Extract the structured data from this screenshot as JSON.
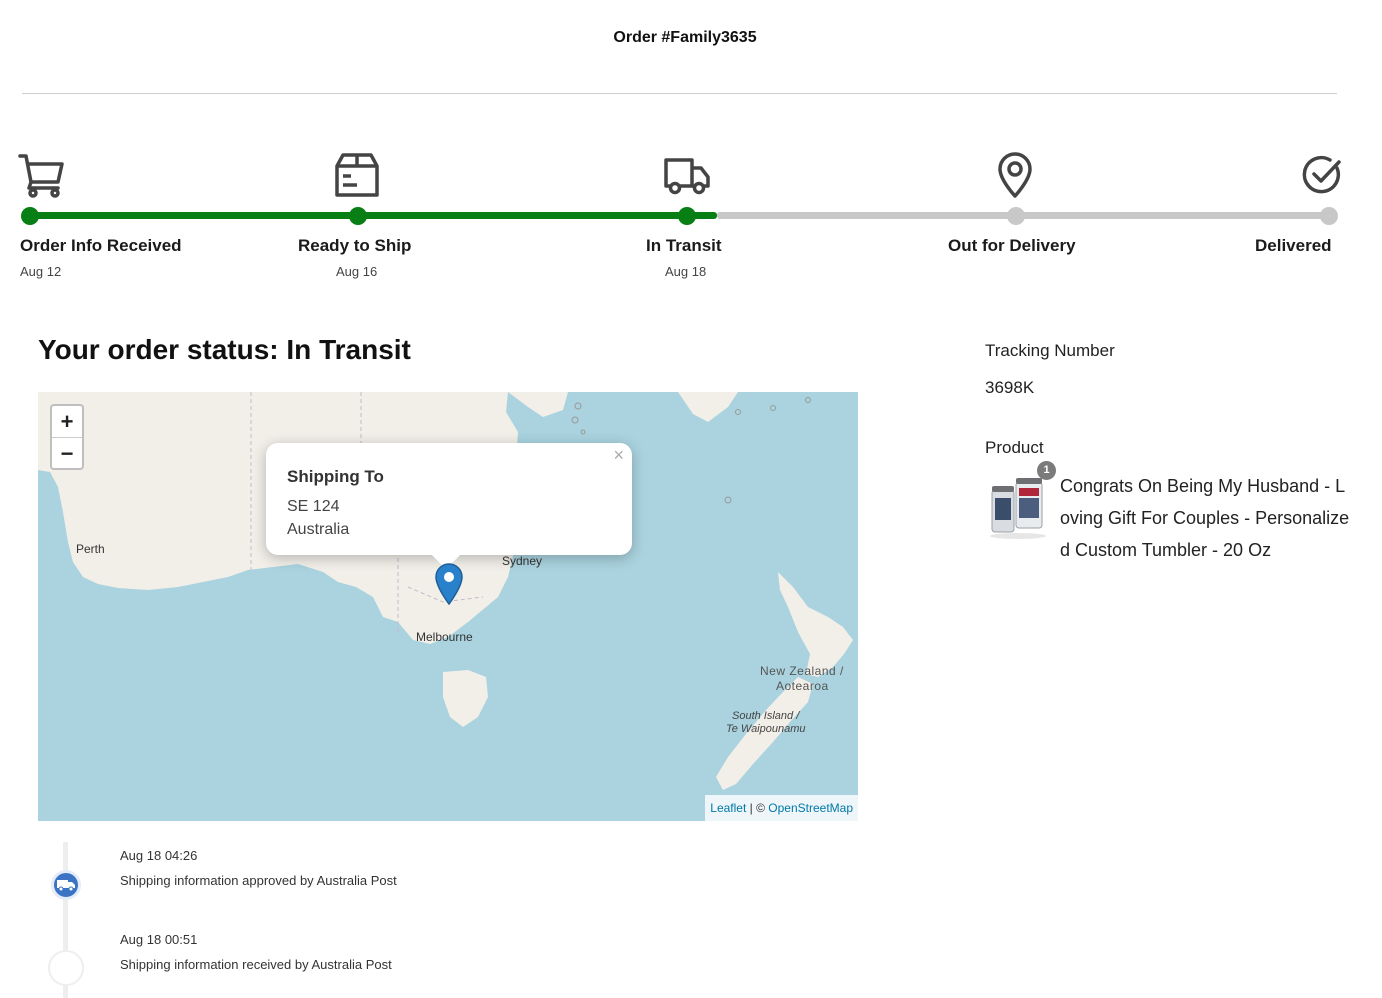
{
  "order": {
    "title": "Order  #Family3635"
  },
  "tracker": {
    "steps": [
      {
        "label": "Order Info Received",
        "date": "Aug 12",
        "icon": "cart-icon",
        "completed": true
      },
      {
        "label": "Ready to Ship",
        "date": "Aug 16",
        "icon": "package-icon",
        "completed": true
      },
      {
        "label": "In Transit",
        "date": "Aug 18",
        "icon": "truck-icon",
        "completed": true
      },
      {
        "label": "Out for Delivery",
        "date": "",
        "icon": "location-pin-icon",
        "completed": false
      },
      {
        "label": "Delivered",
        "date": "",
        "icon": "check-circle-icon",
        "completed": false
      }
    ],
    "colors": {
      "completed": "#087f14",
      "pending": "#c8c8c8"
    }
  },
  "status": {
    "heading": "Your order status: In Transit"
  },
  "map": {
    "zoom_in": "+",
    "zoom_out": "−",
    "labels": {
      "perth": "Perth",
      "sydney": "Sydney",
      "melbourne": "Melbourne",
      "nz_line1": "New Zealand /",
      "nz_line2": "Aotearoa",
      "si_line1": "South Island /",
      "si_line2": "Te Waipounamu"
    },
    "popup": {
      "close": "×",
      "title": "Shipping To",
      "line1": "SE 124",
      "line2": "Australia"
    },
    "attribution": {
      "leaflet": "Leaflet",
      "separator": " | © ",
      "osm": "OpenStreetMap"
    },
    "colors": {
      "water": "#aad3df",
      "land": "#f2efe9",
      "pin": "#2a81cb"
    }
  },
  "tracking": {
    "label": "Tracking Number",
    "number": "3698K"
  },
  "product": {
    "label": "Product",
    "quantity": "1",
    "name": "Congrats On Being My Husband - Loving Gift For Couples - Personalized Custom Tumbler - 20 Oz"
  },
  "timeline": [
    {
      "time": "Aug 18 04:26",
      "description": "Shipping information approved by Australia Post"
    },
    {
      "time": "Aug 18 00:51",
      "description": "Shipping information received by Australia Post"
    }
  ]
}
